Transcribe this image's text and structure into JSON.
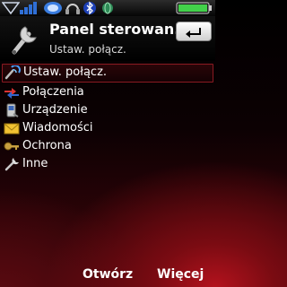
{
  "status_bar": {
    "icons": [
      "signal-icon",
      "network-3g-icon",
      "message-icon",
      "headset-icon",
      "bluetooth-icon",
      "globe-icon",
      "battery-icon"
    ]
  },
  "header": {
    "title": "Panel sterowan.",
    "subtitle": "Ustaw. połącz.",
    "icon": "wrench-icon",
    "back_icon": "back-arrow-icon"
  },
  "menu": {
    "items": [
      {
        "label": "Ustaw. połącz.",
        "icon": "connection-settings-icon",
        "selected": true
      },
      {
        "label": "Połączenia",
        "icon": "calls-icon"
      },
      {
        "label": "Urządzenie",
        "icon": "device-icon"
      },
      {
        "label": "Wiadomości",
        "icon": "envelope-icon"
      },
      {
        "label": "Ochrona",
        "icon": "key-icon"
      },
      {
        "label": "Inne",
        "icon": "tools-icon"
      }
    ]
  },
  "softkeys": {
    "left": "Otwórz",
    "right": "Więcej"
  },
  "colors": {
    "selection_border": "#8a1a22",
    "background_accent": "#b3121d"
  }
}
